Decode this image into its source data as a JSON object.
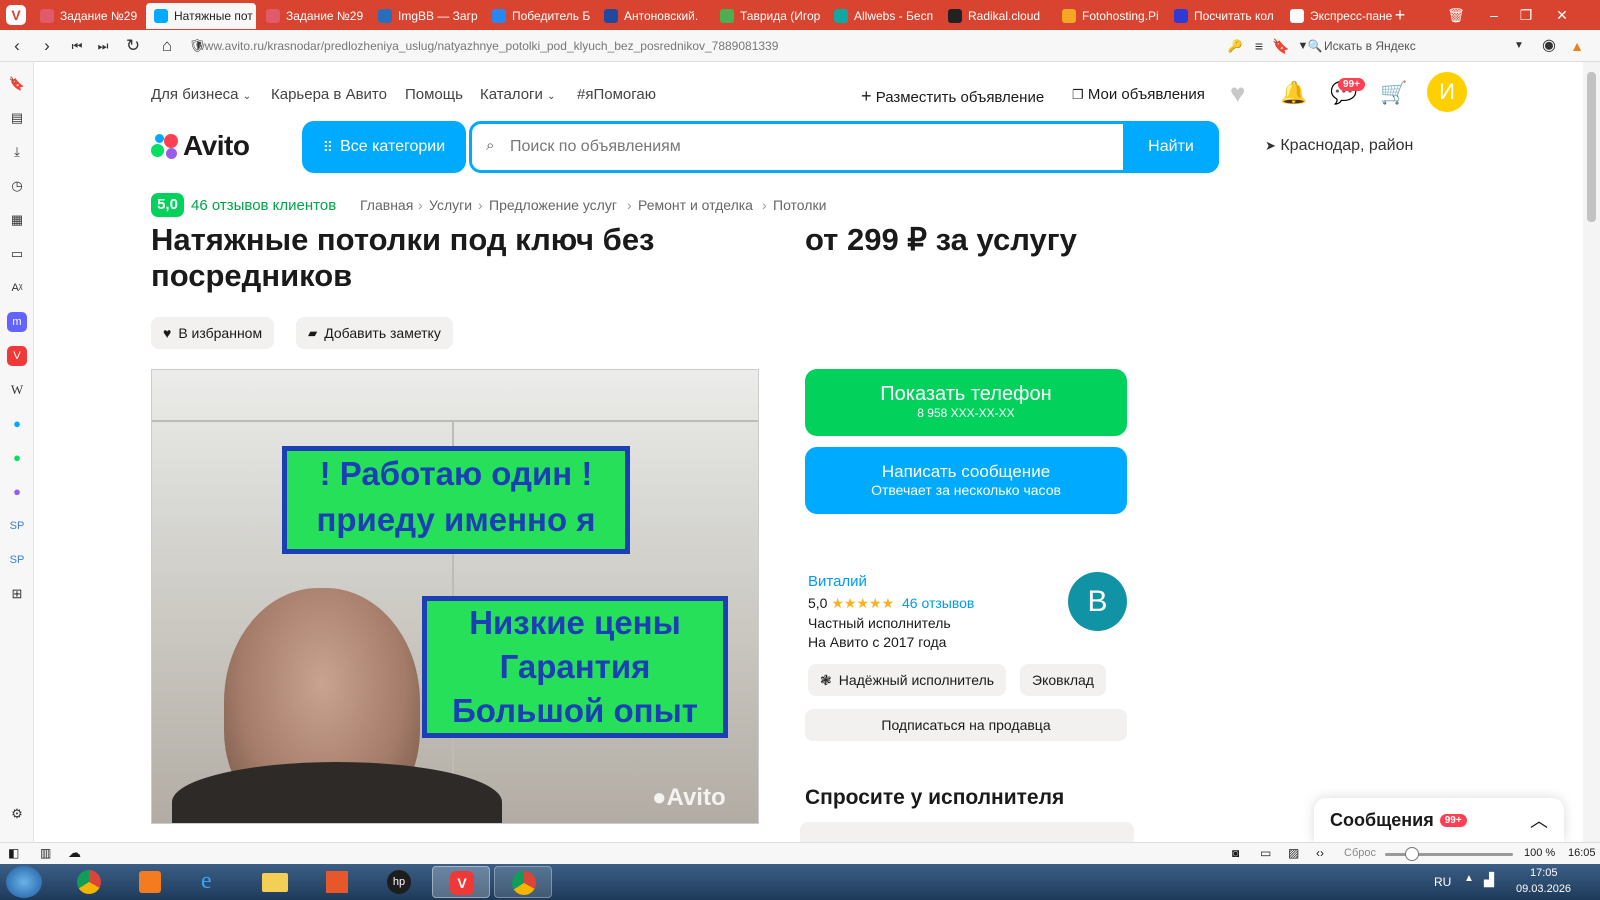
{
  "browser": {
    "tabs": [
      {
        "label": "Задание №29",
        "favicon_color": "#e15a6b"
      },
      {
        "label": "Натяжные пот",
        "favicon_color": "#00aaff",
        "active": true
      },
      {
        "label": "Задание №29",
        "favicon_color": "#e15a6b"
      },
      {
        "label": "ImgBB — Загр",
        "favicon_color": "#2a6ebb"
      },
      {
        "label": "Победитель Б",
        "favicon_color": "#2787f5"
      },
      {
        "label": "Антоновский.",
        "favicon_color": "#1f4a9f"
      },
      {
        "label": "Таврида (Игор",
        "favicon_color": "#4caf50"
      },
      {
        "label": "Allwebs - Бесп",
        "favicon_color": "#13a7a2"
      },
      {
        "label": "Radikal.cloud",
        "favicon_color": "#222222"
      },
      {
        "label": "Fotohosting.Pi",
        "favicon_color": "#f5a623"
      },
      {
        "label": "Посчитать кол",
        "favicon_color": "#2f3ad6"
      },
      {
        "label": "Экспресс-пане",
        "favicon_color": "#ffffff"
      }
    ],
    "url": "www.avito.ru/krasnodar/predlozheniya_uslug/natyazhnye_potolki_pod_klyuch_bez_posrednikov_7889081339",
    "search_placeholder": "Искать в Яндекс",
    "status": {
      "reset": "Сброс",
      "zoom": "100 %",
      "time": "16:05"
    }
  },
  "avito": {
    "top_nav": {
      "business": "Для бизнеса",
      "career": "Карьера в Авито",
      "help": "Помощь",
      "catalogs": "Каталоги",
      "help_tag": "#яПомогаю",
      "post_ad": "Разместить объявление",
      "my_ads": "Мои объявления",
      "messages_badge": "99+",
      "avatar_letter": "И"
    },
    "logo": "Avito",
    "all_categories": "Все категории",
    "search_placeholder": "Поиск по объявлениям",
    "search_button": "Найти",
    "location": "Краснодар, район",
    "rating": {
      "score": "5,0",
      "reviews": "46 отзывов клиентов"
    },
    "breadcrumbs": [
      "Главная",
      "Услуги",
      "Предложение услуг",
      "Ремонт и отделка",
      "Потолки"
    ],
    "title": "Натяжные потолки под ключ без посредников",
    "price": "от 299 ₽ за услугу",
    "favorite_button": "В избранном",
    "note_button": "Добавить заметку",
    "photo": {
      "sign1_line1": "! Работаю один !",
      "sign1_line2": "приеду именно я",
      "sign2_line1": "Низкие цены",
      "sign2_line2": "Гарантия",
      "sign2_line3": "Большой опыт",
      "watermark": "Avito"
    },
    "show_phone": {
      "label": "Показать телефон",
      "number": "8 958 XXX-XX-XX"
    },
    "write_message": {
      "label": "Написать сообщение",
      "sub": "Отвечает за несколько часов"
    },
    "seller": {
      "name": "Виталий",
      "score": "5,0",
      "stars": "★★★★★",
      "reviews": "46 отзывов",
      "type": "Частный исполнитель",
      "since": "На Авито с 2017 года",
      "avatar_letter": "В",
      "badge_reliable": "Надёжный исполнитель",
      "badge_eco": "Эковклад",
      "subscribe": "Подписаться на продавца"
    },
    "ask_title": "Спросите у исполнителя",
    "messages_widget": {
      "label": "Сообщения",
      "badge": "99+"
    }
  },
  "taskbar": {
    "lang": "RU",
    "time": "17:05",
    "date": "09.03.2026"
  }
}
